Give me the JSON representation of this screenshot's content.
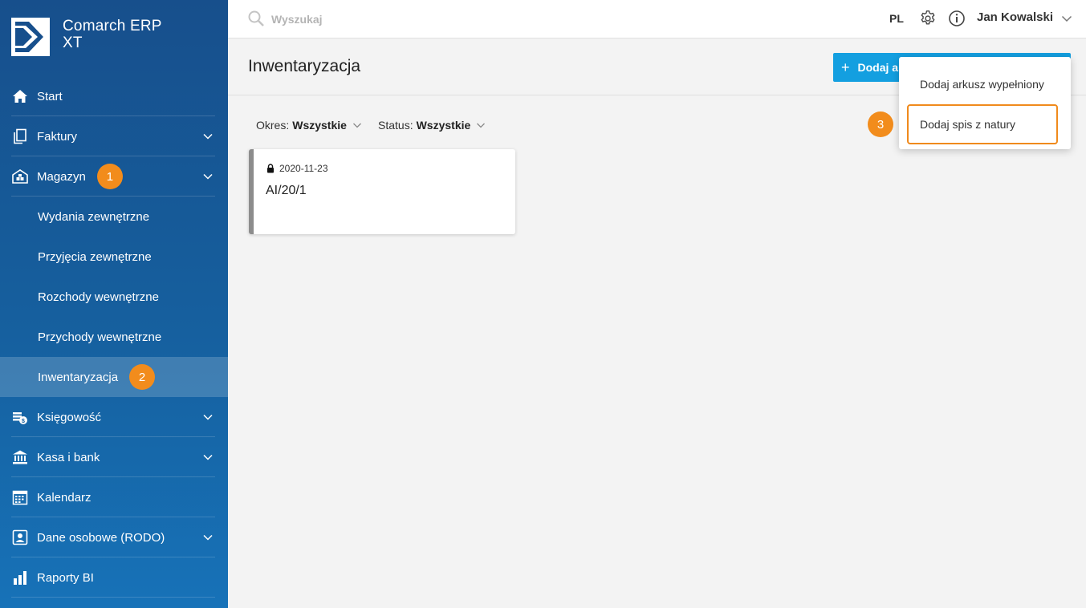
{
  "app": {
    "logo_line1": "Comarch ERP",
    "logo_line2": "XT"
  },
  "sidebar": {
    "items": [
      {
        "label": "Start",
        "icon": "home-icon"
      },
      {
        "label": "Faktury",
        "icon": "documents-icon"
      },
      {
        "label": "Magazyn",
        "icon": "warehouse-icon",
        "badge": "1"
      },
      {
        "label": "Wydania zewnętrzne"
      },
      {
        "label": "Przyjęcia zewnętrzne"
      },
      {
        "label": "Rozchody wewnętrzne"
      },
      {
        "label": "Przychody wewnętrzne"
      },
      {
        "label": "Inwentaryzacja",
        "badge": "2",
        "active": true
      },
      {
        "label": "Księgowość",
        "icon": "accounting-icon"
      },
      {
        "label": "Kasa i bank",
        "icon": "bank-icon"
      },
      {
        "label": "Kalendarz",
        "icon": "calendar-icon"
      },
      {
        "label": "Dane osobowe (RODO)",
        "icon": "person-card-icon"
      },
      {
        "label": "Raporty BI",
        "icon": "bar-chart-icon"
      }
    ]
  },
  "topbar": {
    "search_placeholder": "Wyszukaj",
    "language": "PL",
    "user_name": "Jan Kowalski"
  },
  "page": {
    "title": "Inwentaryzacja",
    "add_button_label": "Dodaj a"
  },
  "filters": {
    "period_label": "Okres:",
    "period_value": "Wszystkie",
    "status_label": "Status:",
    "status_value": "Wszystkie"
  },
  "cards": [
    {
      "date": "2020-11-23",
      "number": "AI/20/1",
      "locked": true
    }
  ],
  "dropdown": {
    "badge": "3",
    "items": [
      "Dodaj arkusz wypełniony",
      "Dodaj spis z natury"
    ]
  },
  "colors": {
    "accent": "#139fe0",
    "highlight": "#f28c1c",
    "sidebar": "#16609f"
  }
}
